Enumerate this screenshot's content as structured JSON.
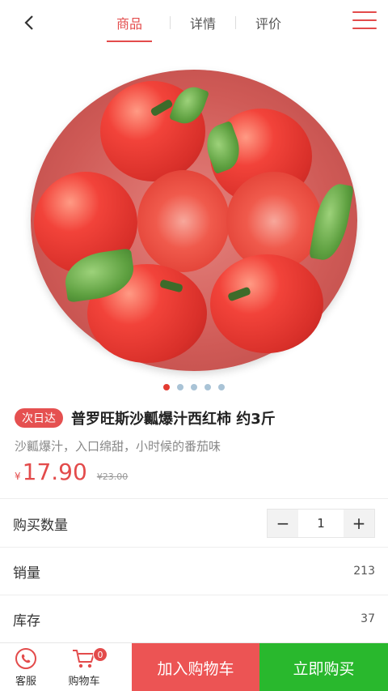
{
  "nav": {
    "back_icon": "chevron-left-icon",
    "tabs": [
      {
        "label": "商品",
        "active": true
      },
      {
        "label": "详情",
        "active": false
      },
      {
        "label": "评价",
        "active": false
      }
    ],
    "menu_icon": "hamburger-menu-icon",
    "accent_color": "#e34b4b"
  },
  "gallery": {
    "image": "tomatoes-in-bowl",
    "dot_count": 5,
    "active_dot": 0
  },
  "product": {
    "badge": "次日达",
    "title": "普罗旺斯沙瓤爆汁西红柿 约3斤",
    "subtitle": "沙瓤爆汁，入口绵甜，小时候的番茄味",
    "currency": "¥",
    "price": "17.90",
    "old_price": "¥23.00"
  },
  "details": {
    "quantity_label": "购买数量",
    "quantity_value": "1",
    "minus": "−",
    "plus": "+",
    "sales_label": "销量",
    "sales_value": "213",
    "stock_label": "库存",
    "stock_value": "37"
  },
  "bottom": {
    "service_label": "客服",
    "cart_label": "购物车",
    "cart_count": "0",
    "add_to_cart": "加入购物车",
    "buy_now": "立即购买",
    "add_color": "#ec5454",
    "buy_color": "#29b82d"
  }
}
